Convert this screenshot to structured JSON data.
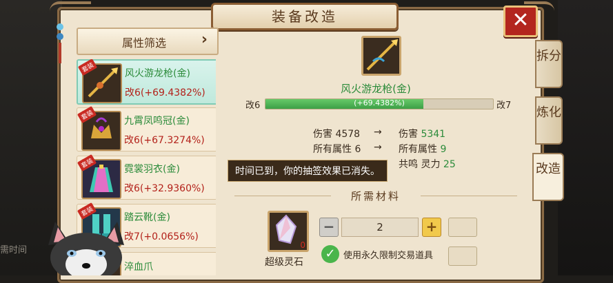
{
  "window": {
    "title": "装备改造",
    "close_label": "✕"
  },
  "filter": {
    "label": "属性筛选",
    "arrow": "›"
  },
  "items": [
    {
      "tag": "套装",
      "name": "风火游龙枪(金)",
      "level": "改6(+69.4382%)"
    },
    {
      "tag": "套装",
      "name": "九霄凤鸣冠(金)",
      "level": "改6(+67.3274%)"
    },
    {
      "tag": "套装",
      "name": "霓裳羽衣(金)",
      "level": "改6(+32.9360%)"
    },
    {
      "tag": "套装",
      "name": "踏云靴(金)",
      "level": "改7(+0.0656%)"
    },
    {
      "tag": "",
      "name": "淬血爪",
      "level": ""
    }
  ],
  "tabs": [
    "拆分",
    "炼化",
    "改造"
  ],
  "selected": {
    "name": "风火游龙枪(金)",
    "from_level": "改6",
    "to_level": "改7",
    "progress_text": "(+69.4382%)",
    "progress_fraction": 0.694382
  },
  "stats": [
    {
      "label": "伤害",
      "before": "4578",
      "after_label": "伤害",
      "after": "5341"
    },
    {
      "label": "所有属性",
      "before": "6",
      "after_label": "所有属性",
      "after": "9"
    },
    {
      "label": "",
      "before": "",
      "after_label": "共鸣  灵力",
      "after": "25"
    }
  ],
  "toast": "时间已到，你的抽签效果已消失。",
  "materials": {
    "title": "所需材料",
    "stone_name": "超级灵石",
    "stone_count": "0",
    "quantity": "2",
    "minus": "−",
    "plus": "+",
    "checkbox_label": "使用永久限制交易道具"
  },
  "side": {
    "text": "需时间"
  },
  "colors": {
    "gold_name": "#2b8b3a",
    "level_red": "#b3211a",
    "progress": "#4fb756"
  }
}
